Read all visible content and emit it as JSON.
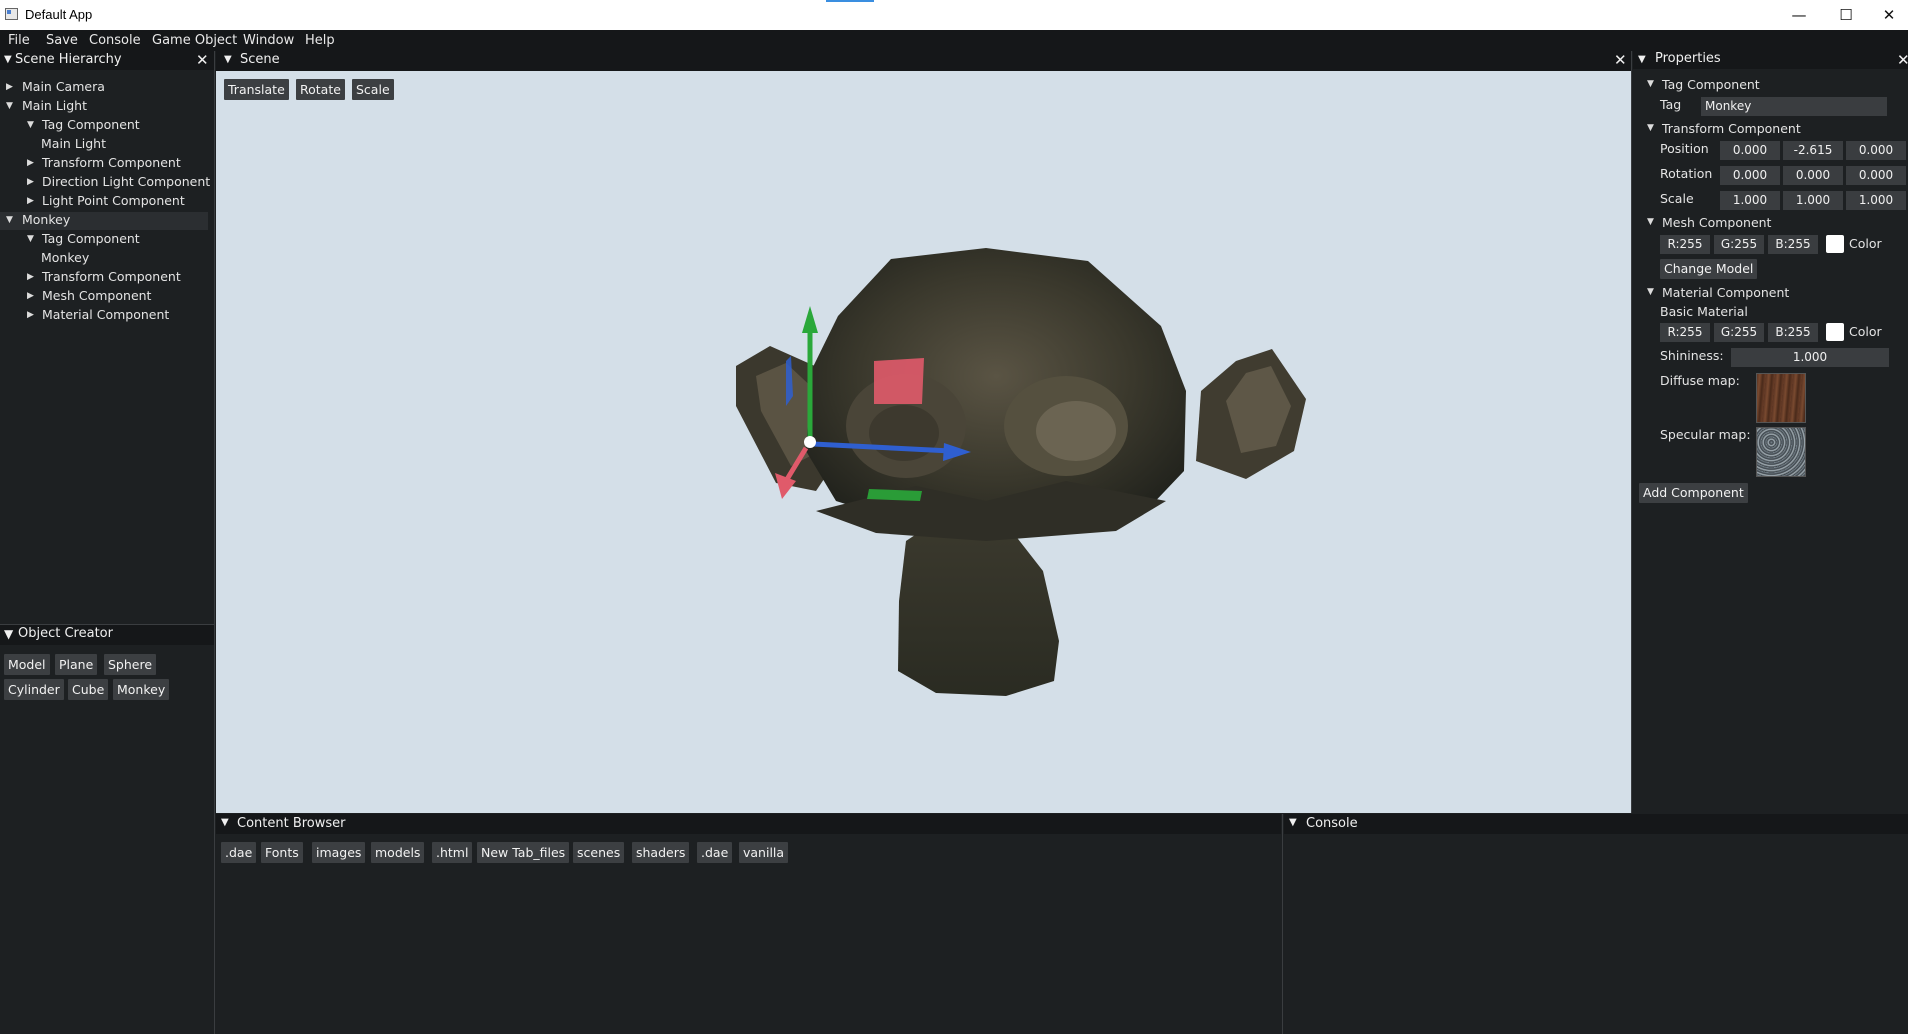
{
  "window": {
    "title": "Default App",
    "minimize": "—",
    "maximize": "☐",
    "close": "✕"
  },
  "menu": [
    "File",
    "Save",
    "Console",
    "Game Object",
    "Window",
    "Help"
  ],
  "hierarchy": {
    "title": "Scene Hierarchy",
    "items": [
      {
        "label": "Main Camera"
      },
      {
        "label": "Main Light"
      },
      {
        "label": "Tag Component"
      },
      {
        "label": "Main Light"
      },
      {
        "label": "Transform Component"
      },
      {
        "label": "Direction Light Component"
      },
      {
        "label": "Light Point Component"
      },
      {
        "label": "Monkey"
      },
      {
        "label": "Tag Component"
      },
      {
        "label": "Monkey"
      },
      {
        "label": "Transform Component"
      },
      {
        "label": "Mesh Component"
      },
      {
        "label": "Material Component"
      }
    ]
  },
  "creator": {
    "title": "Object Creator",
    "buttons": [
      "Model",
      "Plane",
      "Sphere",
      "Cylinder",
      "Cube",
      "Monkey"
    ]
  },
  "scene": {
    "title": "Scene",
    "tools": [
      "Translate",
      "Rotate",
      "Scale"
    ],
    "background": "#d4dfe8"
  },
  "properties": {
    "title": "Properties",
    "tag_header": "Tag Component",
    "tag_label": "Tag",
    "tag_value": "Monkey",
    "transform_header": "Transform Component",
    "position_label": "Position",
    "position": [
      "0.000",
      "-2.615",
      "0.000"
    ],
    "rotation_label": "Rotation",
    "rotation": [
      "0.000",
      "0.000",
      "0.000"
    ],
    "scale_label": "Scale",
    "scale": [
      "1.000",
      "1.000",
      "1.000"
    ],
    "mesh_header": "Mesh Component",
    "mesh_rgb": [
      "R:255",
      "G:255",
      "B:255"
    ],
    "color_label": "Color",
    "change_model": "Change Model",
    "material_header": "Material Component",
    "material_name": "Basic Material",
    "material_rgb": [
      "R:255",
      "G:255",
      "B:255"
    ],
    "shininess_label": "Shininess:",
    "shininess": "1.000",
    "diffuse_label": "Diffuse map:",
    "specular_label": "Specular map:",
    "add_component": "Add Component"
  },
  "content_browser": {
    "title": "Content Browser",
    "items": [
      ".dae",
      "Fonts",
      "images",
      "models",
      ".html",
      "New Tab_files",
      "scenes",
      "shaders",
      ".dae",
      "vanilla"
    ]
  },
  "console": {
    "title": "Console"
  },
  "colors": {
    "panel": "#1d2022",
    "header": "#151719",
    "button": "#3c3f42",
    "gizmo_x": "#e05a6a",
    "gizmo_y": "#2aa83a",
    "gizmo_z": "#2f5fd0"
  }
}
